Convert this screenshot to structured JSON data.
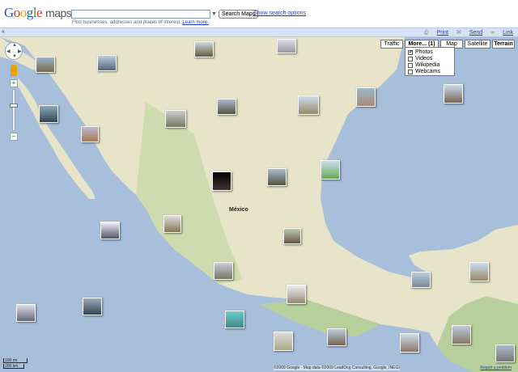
{
  "header": {
    "logo_g1": "G",
    "logo_o1": "o",
    "logo_o2": "o",
    "logo_g2": "g",
    "logo_l": "l",
    "logo_e": "e",
    "logo_maps": "maps",
    "search_value": "",
    "search_button": "Search Maps",
    "search_options": "Show search options",
    "hint_text": "Find businesses, addresses and places of interest.",
    "hint_link": "Learn more."
  },
  "toolbar": {
    "toggle": "«",
    "print_label": "Print",
    "send_label": "Send",
    "link_label": "Link"
  },
  "map_types": {
    "traffic": "Traffic",
    "more": "More... (1)",
    "map": "Map",
    "satellite": "Satellite",
    "terrain": "Terrain"
  },
  "more_panel": {
    "photos": "Photos",
    "videos": "Videos",
    "wikipedia": "Wikipedia",
    "webcams": "Webcams",
    "check": "✔"
  },
  "map": {
    "city_label": "México",
    "scale_top": "100 mi",
    "scale_bottom": "200 km",
    "copyright": "©2009 Google - Map data ©2009 LeadDog Consulting, Google, INEGI",
    "report": "Report a problem"
  },
  "colors": {
    "water": "#a7bfdb",
    "land": "#e8e4c9",
    "green": "#b7cf9a",
    "link": "#1a3dc1"
  }
}
